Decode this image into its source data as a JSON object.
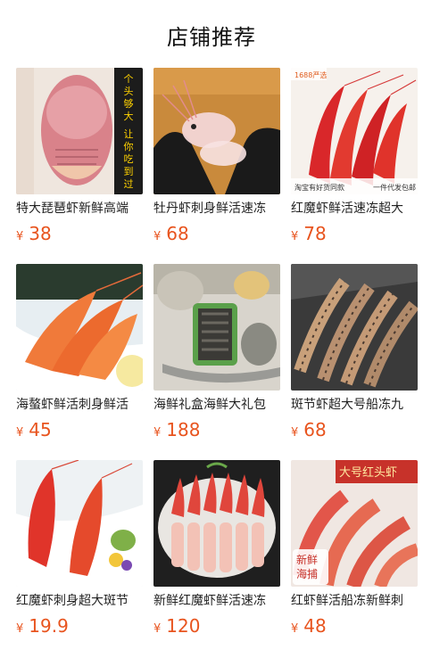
{
  "page_title": "店铺推荐",
  "currency_symbol": "¥",
  "colors": {
    "price": "#e8541e",
    "title": "#111111"
  },
  "products": [
    {
      "name": "特大琵琶虾新鲜高端",
      "price": "38",
      "badge": "个头够大 让你吃到过瘾"
    },
    {
      "name": "牡丹虾刺身鲜活速冻",
      "price": "68"
    },
    {
      "name": "红魔虾鲜活速冻超大",
      "price": "78",
      "badge_top": "1688严选",
      "badge_bottom_left": "淘宝有好货同款",
      "badge_bottom_right": "一件代发包邮"
    },
    {
      "name": "海螯虾鲜活刺身鲜活",
      "price": "45"
    },
    {
      "name": "海鲜礼盒海鲜大礼包",
      "price": "188"
    },
    {
      "name": "斑节虾超大号船冻九",
      "price": "68"
    },
    {
      "name": "红魔虾刺身超大斑节",
      "price": "19.9"
    },
    {
      "name": "新鲜红魔虾鲜活速冻",
      "price": "120"
    },
    {
      "name": "红虾鲜活船冻新鲜刺",
      "price": "48",
      "badge": "大号红头虾",
      "stamp": "新鲜海捕"
    }
  ]
}
